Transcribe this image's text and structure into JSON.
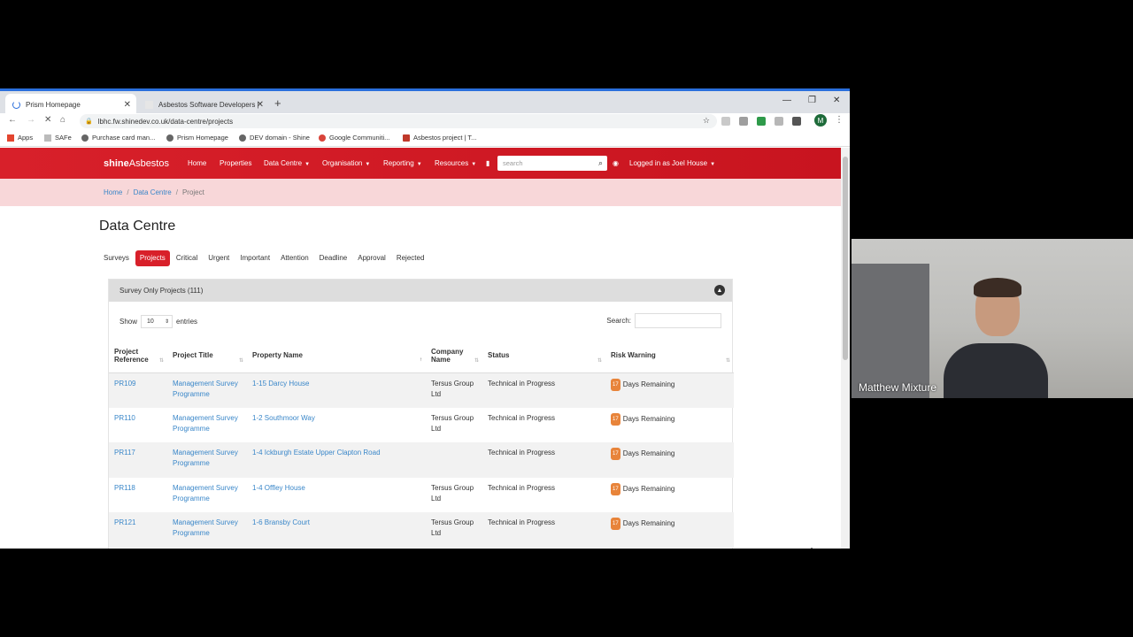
{
  "browser": {
    "tabs": [
      {
        "title": "Prism Homepage",
        "active": true
      },
      {
        "title": "Asbestos Software Developers |",
        "active": false
      }
    ],
    "new_tab": "+",
    "url": "lbhc.fw.shinedev.co.uk/data-centre/projects",
    "profile_initial": "M",
    "bookmarks": [
      "Apps",
      "SAFe",
      "Purchase card man...",
      "Prism Homepage",
      "DEV domain - Shine",
      "Google Communiti...",
      "Asbestos project | T..."
    ]
  },
  "navbar": {
    "brand_bold": "shine",
    "brand_rest": "Asbestos",
    "links": [
      {
        "label": "Home",
        "dropdown": false
      },
      {
        "label": "Properties",
        "dropdown": false
      },
      {
        "label": "Data Centre",
        "dropdown": true
      },
      {
        "label": "Organisation",
        "dropdown": true
      },
      {
        "label": "Reporting",
        "dropdown": true
      },
      {
        "label": "Resources",
        "dropdown": true
      }
    ],
    "search_placeholder": "search",
    "user_label": "Logged in as Joel House"
  },
  "breadcrumb": [
    "Home",
    "Data Centre",
    "Project"
  ],
  "page_title": "Data Centre",
  "filter_tabs": [
    {
      "label": "Surveys",
      "active": false
    },
    {
      "label": "Projects",
      "active": true
    },
    {
      "label": "Critical",
      "active": false
    },
    {
      "label": "Urgent",
      "active": false
    },
    {
      "label": "Important",
      "active": false
    },
    {
      "label": "Attention",
      "active": false
    },
    {
      "label": "Deadline",
      "active": false
    },
    {
      "label": "Approval",
      "active": false
    },
    {
      "label": "Rejected",
      "active": false
    }
  ],
  "panel": {
    "title": "Survey Only Projects (111)",
    "show_label": "Show",
    "entries_value": "10",
    "entries_label": "entries",
    "search_label": "Search:"
  },
  "table": {
    "columns": [
      "Project Reference",
      "Project Title",
      "Property Name",
      "Company Name",
      "Status",
      "Risk Warning"
    ],
    "rows": [
      {
        "ref": "PR109",
        "title": "Management Survey Programme",
        "property": "1-15 Darcy House",
        "company": "Tersus Group Ltd",
        "status": "Technical in Progress",
        "risk_days": "17",
        "risk_text": "Days Remaining"
      },
      {
        "ref": "PR110",
        "title": "Management Survey Programme",
        "property": "1-2 Southmoor Way",
        "company": "Tersus Group Ltd",
        "status": "Technical in Progress",
        "risk_days": "17",
        "risk_text": "Days Remaining"
      },
      {
        "ref": "PR117",
        "title": "Management Survey Programme",
        "property": "1-4 Ickburgh Estate Upper Clapton Road",
        "company": "",
        "status": "Technical in Progress",
        "risk_days": "17",
        "risk_text": "Days Remaining"
      },
      {
        "ref": "PR118",
        "title": "Management Survey Programme",
        "property": "1-4 Offley House",
        "company": "Tersus Group Ltd",
        "status": "Technical in Progress",
        "risk_days": "17",
        "risk_text": "Days Remaining"
      },
      {
        "ref": "PR121",
        "title": "Management Survey Programme",
        "property": "1-6 Bransby Court",
        "company": "Tersus Group Ltd",
        "status": "Technical in Progress",
        "risk_days": "17",
        "risk_text": "Days Remaining"
      }
    ]
  },
  "webcam": {
    "name": "Matthew Mixture"
  },
  "colors": {
    "brand_red": "#d8202a",
    "link_blue": "#3a87c9",
    "breadcrumb_bg": "#f8d7d9",
    "badge_orange": "#e8843a"
  }
}
